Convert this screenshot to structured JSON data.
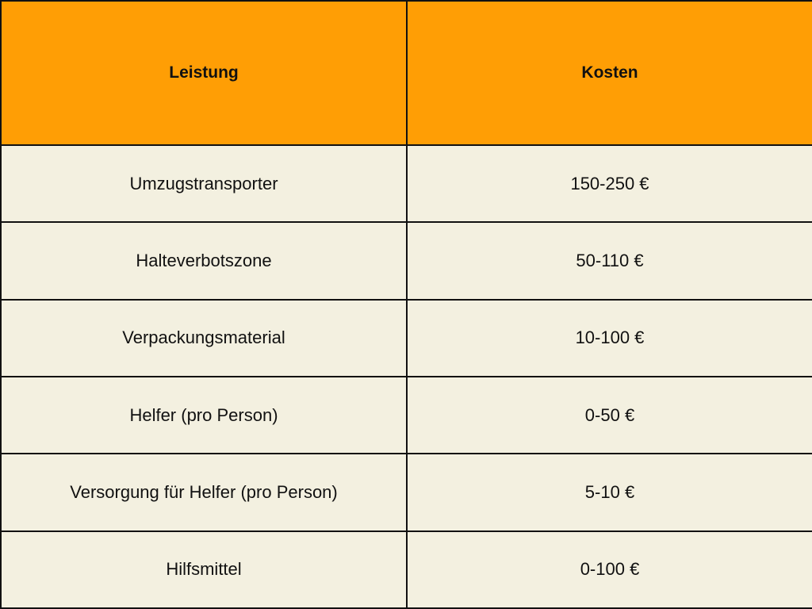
{
  "colors": {
    "header_bg": "#FF9E05",
    "row_bg": "#F3F0E0",
    "border": "#111111",
    "text": "#111111"
  },
  "table": {
    "headers": {
      "service": "Leistung",
      "cost": "Kosten"
    },
    "rows": [
      {
        "service": "Umzugstransporter",
        "cost": "150-250 €"
      },
      {
        "service": "Halteverbotszone",
        "cost": "50-110 €"
      },
      {
        "service": "Verpackungsmaterial",
        "cost": "10-100 €"
      },
      {
        "service": "Helfer (pro Person)",
        "cost": "0-50 €"
      },
      {
        "service": "Versorgung für Helfer (pro Person)",
        "cost": "5-10 €"
      },
      {
        "service": "Hilfsmittel",
        "cost": "0-100 €"
      }
    ]
  }
}
